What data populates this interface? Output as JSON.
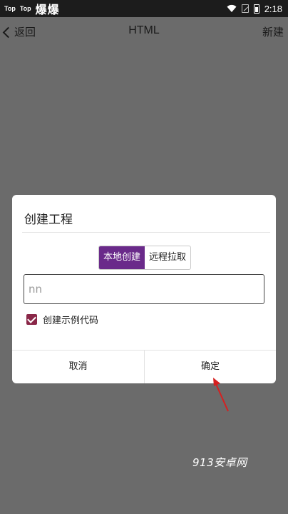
{
  "status_bar": {
    "app1": "Top",
    "app2": "Top",
    "notification_chars": "爆爆",
    "time": "2:18"
  },
  "appbar": {
    "back_label": "返回",
    "title": "HTML",
    "new_label": "新建"
  },
  "dialog": {
    "title": "创建工程",
    "segments": [
      {
        "label": "本地创建",
        "active": true
      },
      {
        "label": "远程拉取",
        "active": false
      }
    ],
    "input_value": "nn",
    "checkbox_label": "创建示例代码",
    "checkbox_checked": true,
    "cancel_label": "取消",
    "ok_label": "确定"
  },
  "watermark": "913安卓网",
  "colors": {
    "accent": "#6a2a8a",
    "checkbox": "#8a2748",
    "arrow": "#d62020"
  }
}
